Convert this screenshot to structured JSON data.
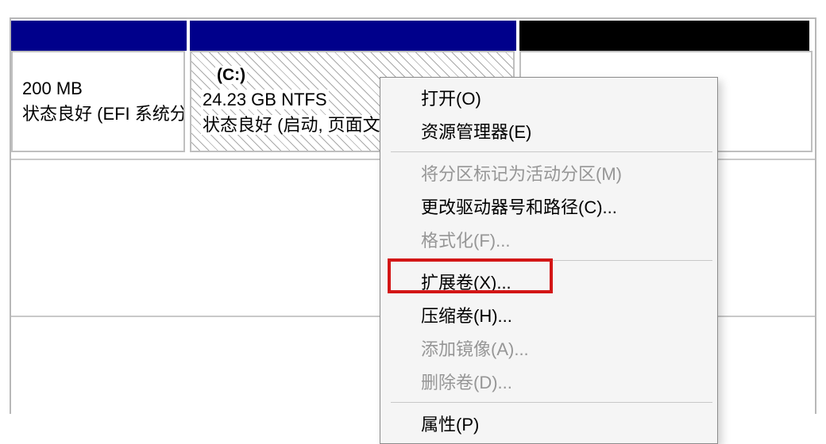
{
  "partitions": {
    "efi": {
      "size": "200 MB",
      "status": "状态良好 (EFI 系统分"
    },
    "c_drive": {
      "label": "(C:)",
      "size_fs": "24.23 GB NTFS",
      "status": "状态良好 (启动, 页面文件"
    }
  },
  "menu": {
    "open": "打开(O)",
    "explorer": "资源管理器(E)",
    "mark_active": "将分区标记为活动分区(M)",
    "change_letter": "更改驱动器号和路径(C)...",
    "format": "格式化(F)...",
    "extend": "扩展卷(X)...",
    "shrink": "压缩卷(H)...",
    "add_mirror": "添加镜像(A)...",
    "delete_vol": "删除卷(D)...",
    "properties": "属性(P)"
  }
}
